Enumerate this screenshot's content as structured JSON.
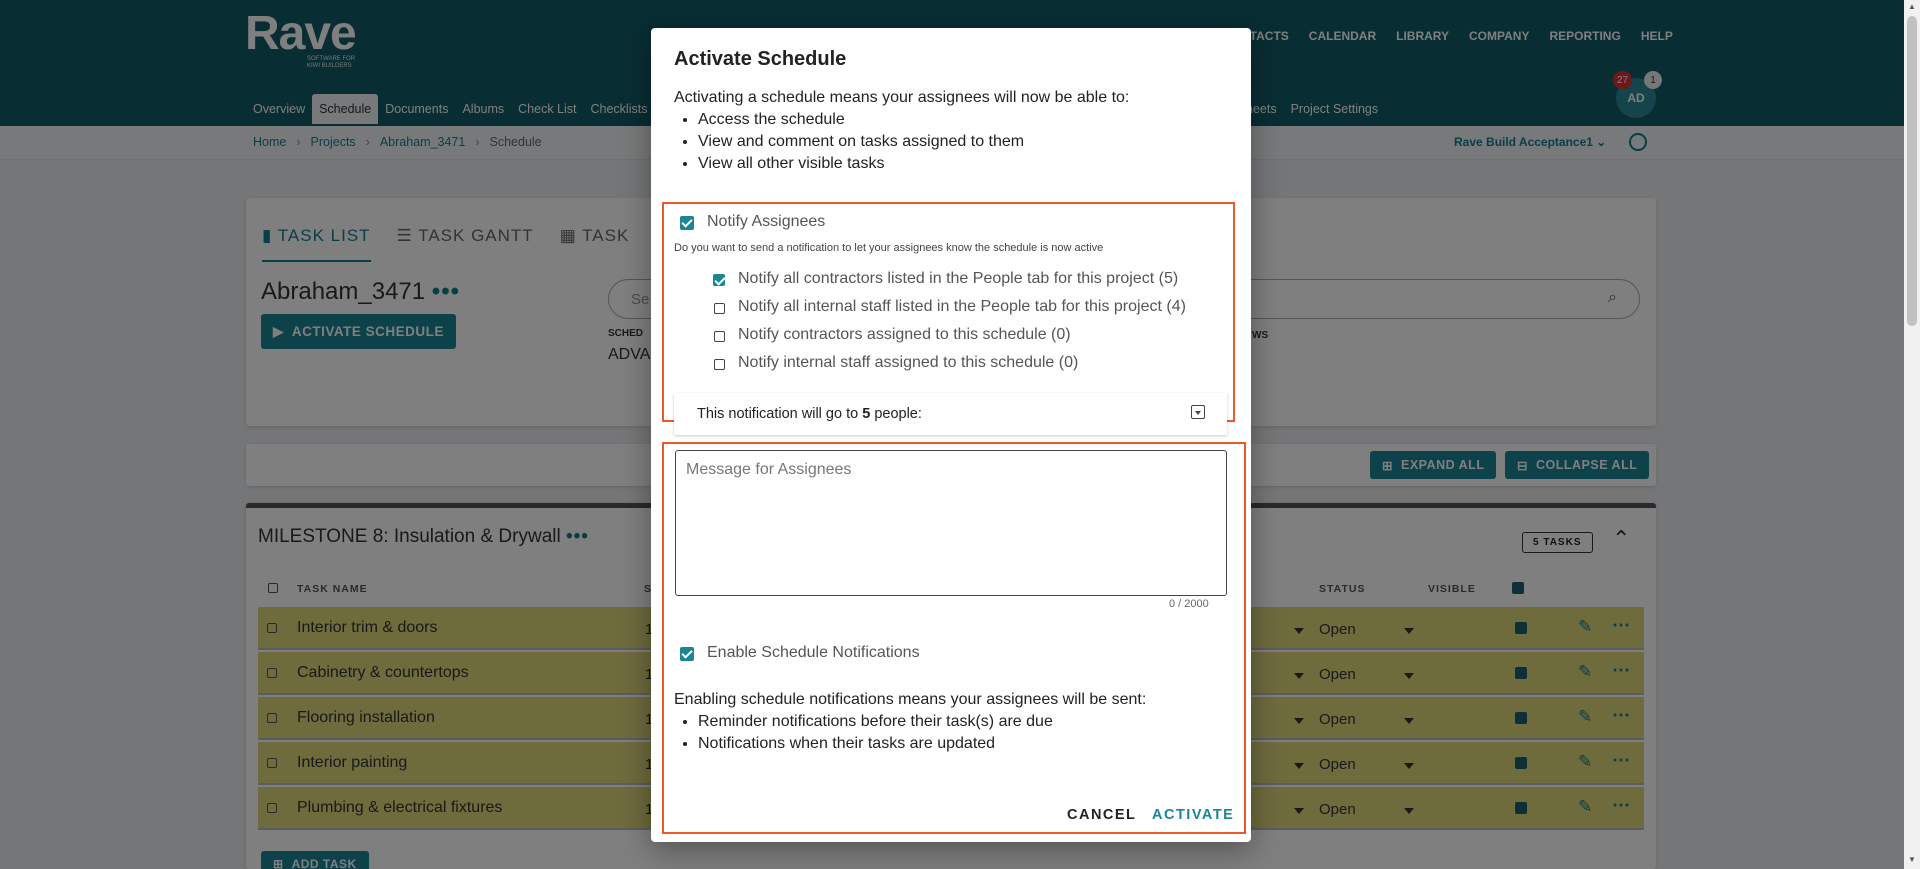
{
  "brand": {
    "name": "Rave",
    "tagline": "SOFTWARE FOR KIWI BUILDERS"
  },
  "topnav": [
    "NTACTS",
    "CALENDAR",
    "LIBRARY",
    "COMPANY",
    "REPORTING",
    "HELP"
  ],
  "subnav": [
    "Overview",
    "Schedule",
    "Documents",
    "Albums",
    "Check List",
    "Checklists"
  ],
  "subnav_right": [
    "heets",
    "Project Settings"
  ],
  "user": {
    "initials": "AD",
    "notifications": "27",
    "messages": "1"
  },
  "breadcrumb": [
    "Home",
    "Projects",
    "Abraham_3471",
    "Schedule"
  ],
  "project_selector": "Rave Build Acceptance1",
  "tabs": [
    "TASK LIST",
    "TASK GANTT",
    "TASK"
  ],
  "project_title": "Abraham_3471",
  "activate_btn": "ACTIVATE SCHEDULE",
  "search_placeholder": "Se",
  "schedule_label": "SCHED",
  "schedule_value": "ADVA",
  "ws_label": "WS",
  "expand_all": "EXPAND ALL",
  "collapse_all": "COLLAPSE ALL",
  "milestone": {
    "title": "MILESTONE 8: Insulation & Drywall",
    "tasks_badge": "5 TASKS"
  },
  "table": {
    "headers": {
      "task": "TASK NAME",
      "s": "S",
      "status": "STATUS",
      "visible": "VISIBLE"
    },
    "rows": [
      {
        "name": "Interior trim & doors",
        "num": "1",
        "status": "Open"
      },
      {
        "name": "Cabinetry & countertops",
        "num": "1",
        "status": "Open"
      },
      {
        "name": "Flooring installation",
        "num": "1",
        "status": "Open"
      },
      {
        "name": "Interior painting",
        "num": "1",
        "status": "Open"
      },
      {
        "name": "Plumbing & electrical fixtures",
        "num": "1",
        "status": "Open"
      }
    ]
  },
  "add_task": "ADD TASK",
  "modal": {
    "title": "Activate Schedule",
    "intro": "Activating a schedule means your assignees will now be able to:",
    "intro_items": [
      "Access the schedule",
      "View and comment on tasks assigned to them",
      "View all other visible tasks"
    ],
    "notify_label": "Notify Assignees",
    "notify_desc": "Do you want to send a notification to let your assignees know the schedule is now active",
    "options": [
      {
        "label": "Notify all contractors listed in the People tab for this project (5)",
        "checked": true
      },
      {
        "label": "Notify all internal staff listed in the People tab for this project (4)",
        "checked": false
      },
      {
        "label": "Notify contractors assigned to this schedule (0)",
        "checked": false
      },
      {
        "label": "Notify internal staff assigned to this schedule (0)",
        "checked": false
      }
    ],
    "notif_prefix": "This notification will go to ",
    "notif_count": "5",
    "notif_suffix": " people:",
    "message_placeholder": "Message for Assignees",
    "counter": "0 / 2000",
    "enable_label": "Enable Schedule Notifications",
    "enable_desc": "Enabling schedule notifications means your assignees will be sent:",
    "enable_items": [
      "Reminder notifications before their task(s) are due",
      "Notifications when their tasks are updated"
    ],
    "cancel": "CANCEL",
    "activate": "ACTIVATE"
  },
  "colors": {
    "header": "#105a66",
    "accent": "#1a8594",
    "highlight": "#ea5a2a",
    "row": "#ddd67a"
  }
}
